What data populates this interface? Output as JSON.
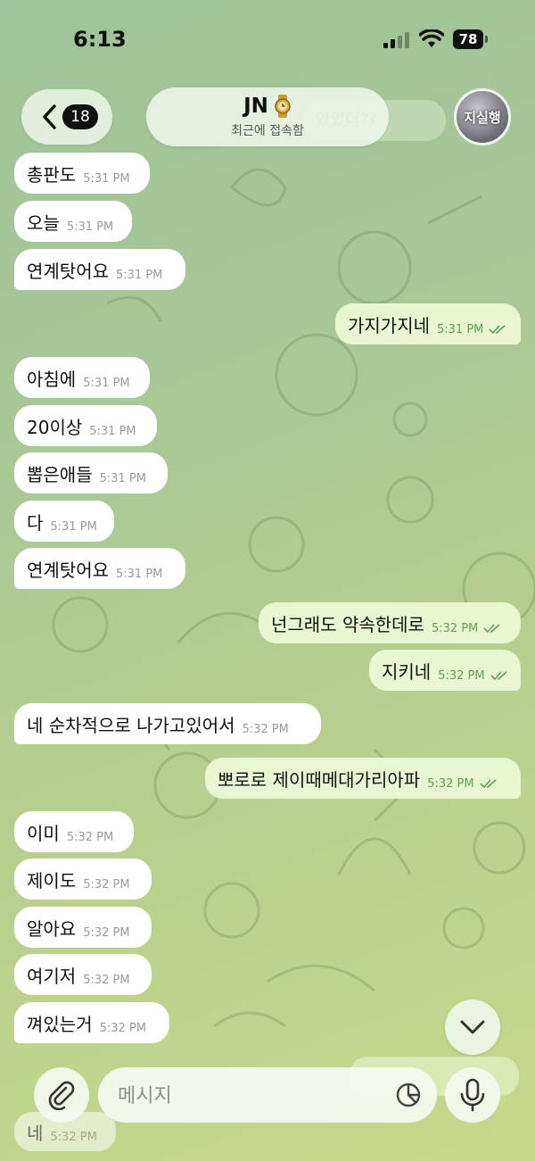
{
  "status_bar": {
    "time": "6:13",
    "battery": "78"
  },
  "header": {
    "back_count": "18",
    "contact_name": "JN",
    "status": "최근에 접속함",
    "avatar_text": "지실행",
    "ghost_top": "있었더??"
  },
  "messages": [
    {
      "dir": "in",
      "text": "총판도",
      "time": "5:31 PM",
      "tail": false
    },
    {
      "dir": "in",
      "text": "오늘",
      "time": "5:31 PM",
      "tail": false
    },
    {
      "dir": "in",
      "text": "연계탓어요",
      "time": "5:31 PM",
      "tail": true
    },
    {
      "dir": "out",
      "text": "가지가지네",
      "time": "5:31 PM",
      "tail": true
    },
    {
      "dir": "in",
      "text": "아침에",
      "time": "5:31 PM",
      "tail": false
    },
    {
      "dir": "in",
      "text": "20이상",
      "time": "5:31 PM",
      "tail": false
    },
    {
      "dir": "in",
      "text": "뽑은애들",
      "time": "5:31 PM",
      "tail": false
    },
    {
      "dir": "in",
      "text": "다",
      "time": "5:31 PM",
      "tail": false
    },
    {
      "dir": "in",
      "text": "연계탓어요",
      "time": "5:31 PM",
      "tail": true
    },
    {
      "dir": "out",
      "text": "넌그래도 약속한데로",
      "time": "5:32 PM",
      "tail": false
    },
    {
      "dir": "out",
      "text": "지키네",
      "time": "5:32 PM",
      "tail": true
    },
    {
      "dir": "in",
      "text": "네 순차적으로 나가고있어서",
      "time": "5:32 PM",
      "tail": true
    },
    {
      "dir": "out",
      "text": "뽀로로 제이때메대가리아파",
      "time": "5:32 PM",
      "tail": true
    },
    {
      "dir": "in",
      "text": "이미",
      "time": "5:32 PM",
      "tail": false
    },
    {
      "dir": "in",
      "text": "제이도",
      "time": "5:32 PM",
      "tail": false
    },
    {
      "dir": "in",
      "text": "알아요",
      "time": "5:32 PM",
      "tail": false
    },
    {
      "dir": "in",
      "text": "여기저",
      "time": "5:32 PM",
      "tail": false
    },
    {
      "dir": "in",
      "text": "껴있는거",
      "time": "5:32 PM",
      "tail": true
    }
  ],
  "ghost_bottom_in": {
    "text": "네",
    "time": "5:32 PM"
  },
  "composer": {
    "placeholder": "메시지"
  },
  "colors": {
    "outgoing_bubble": "#e8f7d2",
    "incoming_bubble": "#ffffff",
    "read_ticks": "#5aa24b"
  },
  "icons": [
    "back-chevron-icon",
    "watch-emoji-icon",
    "chevron-down-icon",
    "paperclip-icon",
    "sticker-icon",
    "microphone-icon"
  ]
}
